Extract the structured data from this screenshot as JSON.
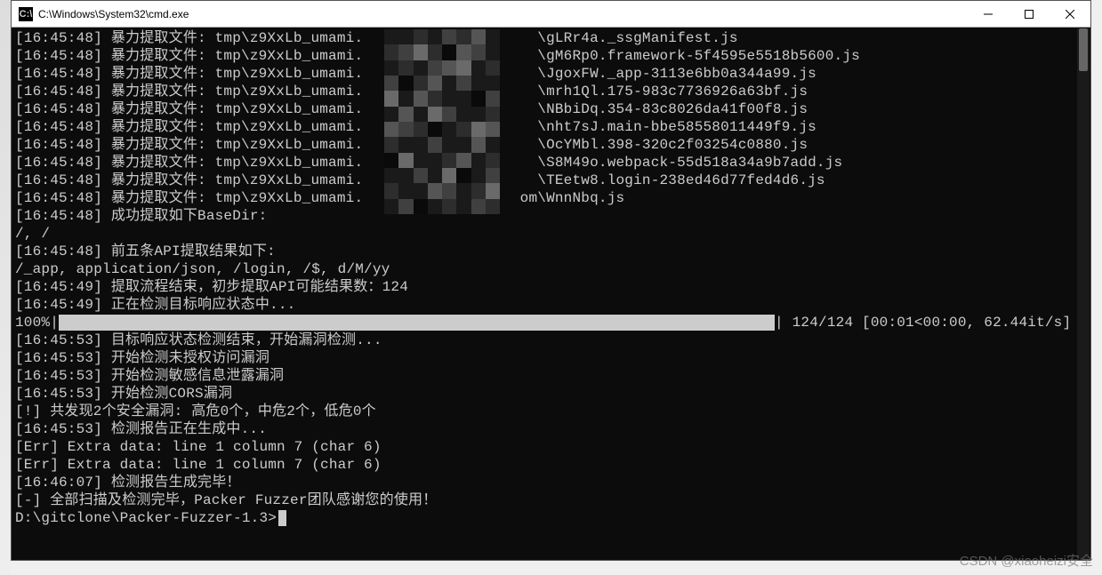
{
  "window": {
    "title": "C:\\Windows\\System32\\cmd.exe",
    "icon_text": "C:\\"
  },
  "terminal": {
    "lines": [
      "[16:45:48] 暴力提取文件: tmp\\z9XxLb_umami.                    \\gLRr4a._ssgManifest.js",
      "[16:45:48] 暴力提取文件: tmp\\z9XxLb_umami.                    \\gM6Rp0.framework-5f4595e5518b5600.js",
      "[16:45:48] 暴力提取文件: tmp\\z9XxLb_umami.                    \\JgoxFW._app-3113e6bb0a344a99.js",
      "[16:45:48] 暴力提取文件: tmp\\z9XxLb_umami.                    \\mrh1Ql.175-983c7736926a63bf.js",
      "[16:45:48] 暴力提取文件: tmp\\z9XxLb_umami.                    \\NBbiDq.354-83c8026da41f00f8.js",
      "[16:45:48] 暴力提取文件: tmp\\z9XxLb_umami.                    \\nht7sJ.main-bbe58558011449f9.js",
      "[16:45:48] 暴力提取文件: tmp\\z9XxLb_umami.                    \\OcYMbl.398-320c2f03254c0880.js",
      "[16:45:48] 暴力提取文件: tmp\\z9XxLb_umami.                    \\S8M49o.webpack-55d518a34a9b7add.js",
      "[16:45:48] 暴力提取文件: tmp\\z9XxLb_umami.                    \\TEetw8.login-238ed46d77fed4d6.js",
      "[16:45:48] 暴力提取文件: tmp\\z9XxLb_umami.                  om\\WnnNbq.js",
      "[16:45:48] 成功提取如下BaseDir:",
      "/, /",
      "[16:45:48] 前五条API提取结果如下:",
      "/_app, application/json, /login, /$, d/M/yy",
      "[16:45:49] 提取流程结束，初步提取API可能结果数：124",
      "[16:45:49] 正在检测目标响应状态中..."
    ],
    "progress": {
      "percent": "100%",
      "suffix": " 124/124 [00:01<00:00, 62.44it/s]"
    },
    "lines_after": [
      "[16:45:53] 目标响应状态检测结束，开始漏洞检测...",
      "[16:45:53] 开始检测未授权访问漏洞",
      "[16:45:53] 开始检测敏感信息泄露漏洞",
      "[16:45:53] 开始检测CORS漏洞",
      "[!] 共发现2个安全漏洞: 高危0个，中危2个，低危0个",
      "[16:45:53] 检测报告正在生成中...",
      "[Err] Extra data: line 1 column 7 (char 6)",
      "[Err] Extra data: line 1 column 7 (char 6)",
      "[16:46:07] 检测报告生成完毕！",
      "[-] 全部扫描及检测完毕，Packer Fuzzer团队感谢您的使用！",
      "",
      "D:\\gitclone\\Packer-Fuzzer-1.3>"
    ]
  },
  "watermark": "CSDN @xiaoheizi安全"
}
